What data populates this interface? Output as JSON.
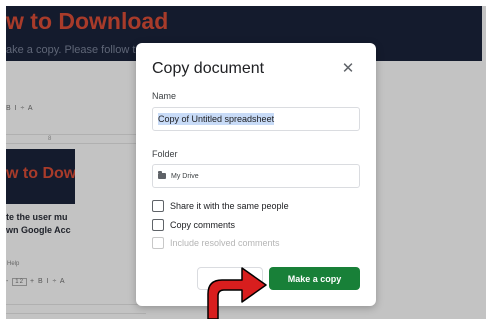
{
  "background": {
    "hero_title": "w to Download",
    "hero_subtitle": "ake a copy. Please follow t",
    "toolbar_top": "B  I  ÷  A",
    "side_card_title": "w to Downlo",
    "side_text_1": "te the user mu",
    "side_text_2": "wn Google Acc",
    "help_label": "Help",
    "toolbar_bottom_prefix": "-",
    "font_size": "12",
    "toolbar_bottom_suffix": "+  B  I  ÷  A"
  },
  "dialog": {
    "title": "Copy document",
    "close_icon": "close-icon",
    "name_label": "Name",
    "name_value": "Copy of Untitled spreadsheet",
    "folder_label": "Folder",
    "folder_value": "My Drive",
    "options": [
      {
        "label": "Share it with the same people",
        "checked": false,
        "disabled": false
      },
      {
        "label": "Copy comments",
        "checked": false,
        "disabled": false
      },
      {
        "label": "Include resolved comments",
        "checked": false,
        "disabled": true
      }
    ],
    "primary_button": "Make a copy"
  },
  "annotation": {
    "arrow_color": "#d81e1e",
    "arrow_icon": "red-arrow-icon"
  },
  "colors": {
    "dialog_primary": "#188038",
    "hero_background": "#141b2d",
    "hero_text": "#a83b2a"
  }
}
